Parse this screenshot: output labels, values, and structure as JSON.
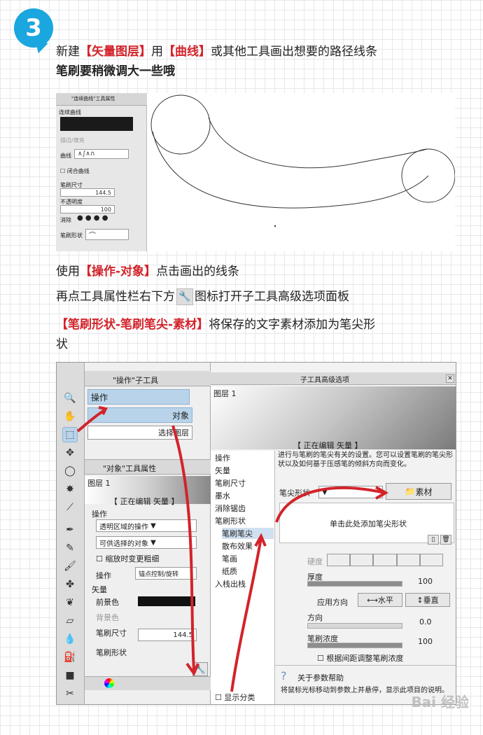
{
  "step_number": "3",
  "para1": {
    "pre": "新建",
    "hl1": "【矢量图层】",
    "mid": "用",
    "hl2": "【曲线】",
    "post": "或其他工具画出想要的路径线条",
    "line2": "笔刷要稍微调大一些哦"
  },
  "shot1": {
    "panel_title": "\"连续曲线\"工具属性",
    "tool_name": "连续曲线",
    "border_fill": "描边/填充",
    "curve": "曲线",
    "close_curve": "闭合曲线",
    "brush_size_label": "笔刷尺寸",
    "brush_size_value": "144.5",
    "opacity_label": "不透明度",
    "opacity_value": "100",
    "antialias_label": "消除",
    "brush_shape_label": "笔刷形状"
  },
  "para2": {
    "pre": "使用",
    "hl": "【操作-对象】",
    "post": "点击画出的线条"
  },
  "para3": {
    "pre": "再点工具属性栏右下方",
    "post": "图标打开子工具高级选项面板"
  },
  "para4": {
    "hl": "【笔刷形状-笔刷笔尖-素材】",
    "post": "将保存的文字素材添加为笔尖形",
    "line2": "状"
  },
  "shot2": {
    "subtool_title": "\"操作\"子工具",
    "subtool_active": "操作",
    "subtool_object": "对象",
    "subtool_layer": "选择图层",
    "obj_panel_title": "\"对象\"工具属性",
    "layer_name": "图层 1",
    "editing_label": "【 正在编辑 矢量 】",
    "operation_label": "操作",
    "transparent_area": "透明区域的操作",
    "selectable": "可供选择的对象",
    "scale_change": "缩放时变更粗细",
    "op2_label": "操作",
    "op2_value": "锚点控制/旋转",
    "vector_label": "矢量",
    "main_color": "前景色",
    "bg_color": "背景色",
    "brush_size_label": "笔刷尺寸",
    "brush_size_value": "144.5",
    "brush_shape_label": "笔刷形状",
    "adv_title": "子工具高级选项",
    "adv_layer": "图层 1",
    "adv_editing": "【 正在编辑 矢量 】",
    "categories": [
      "操作",
      "矢量",
      "笔刷尺寸",
      "墨水",
      "消除锯齿",
      "笔刷形状",
      "笔刷笔尖",
      "散布效果",
      "笔画",
      "纸质",
      "入栈出栈"
    ],
    "show_category": "显示分类",
    "desc": "进行与笔刷的笔尖有关的设置。您可以设置笔刷的笔尖形状以及如何基于压感笔的倾斜方向而变化。",
    "tip_shape_label": "笔尖形状",
    "material_btn": "素材",
    "add_tip_text": "单击此处添加笔尖形状",
    "hardness_label": "硬度",
    "thickness_label": "厚度",
    "thickness_value": "100",
    "apply_dir_label": "应用方向",
    "horizontal": "水平",
    "vertical": "垂直",
    "direction_label": "方向",
    "direction_value": "0.0",
    "density_label": "笔刷浓度",
    "density_value": "100",
    "adjust_density": "根据间距调整笔刷浓度",
    "help_title": "关于参数帮助",
    "help_desc": "将鼠标光标移动到参数上并悬停，显示此项目的说明。"
  },
  "watermark": "Bai 经验"
}
